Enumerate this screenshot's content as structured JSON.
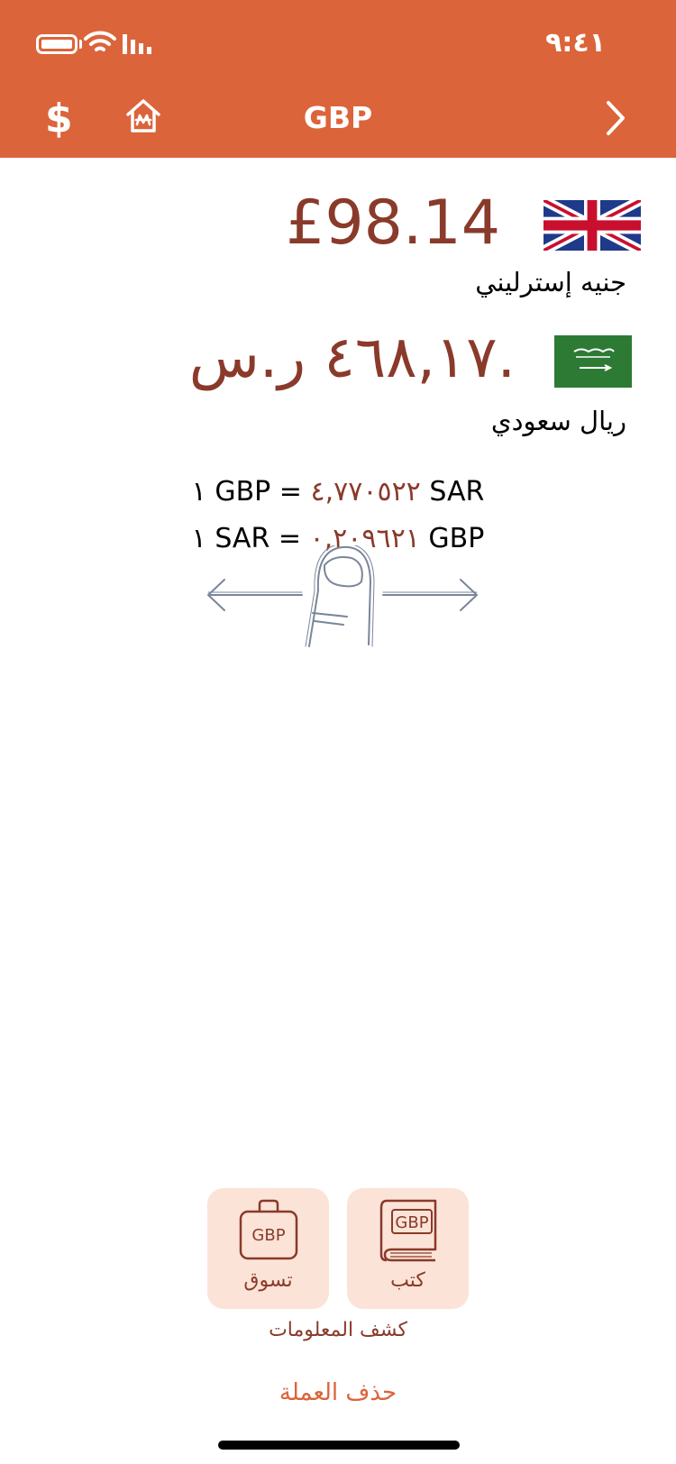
{
  "status_bar": {
    "time": "٩:٤١"
  },
  "nav": {
    "title": "GBP",
    "dollar_symbol": "$",
    "left_icon_1": "dollar-icon",
    "left_icon_2": "house-currency-icon",
    "right_icon": "chevron-right-icon"
  },
  "base_currency": {
    "amount": "£98.14",
    "name": "جنيه إسترليني"
  },
  "target_currency": {
    "amount": "٤٦٨,١٧ ر.س.",
    "name": "ريال سعودي"
  },
  "rates": {
    "line1_prefix": "١ GBP  =  ",
    "line1_value": "٤,٧٧٠٥٢٢",
    "line1_suffix": " SAR",
    "line2_prefix": "١ SAR  =  ",
    "line2_value": "٠,٢٠٩٦٢١",
    "line2_suffix": " GBP"
  },
  "actions": {
    "books_label": "كتب",
    "books_icon_text": "GBP",
    "shop_label": "تسوق",
    "shop_icon_text": "GBP",
    "info_caption": "كشف المعلومات",
    "delete_label": "حذف العملة"
  },
  "colors": {
    "header": "#DC643A",
    "amount_text": "#8A3A2A",
    "tile_bg": "#FBE3D7",
    "delete_text": "#DC643A"
  }
}
